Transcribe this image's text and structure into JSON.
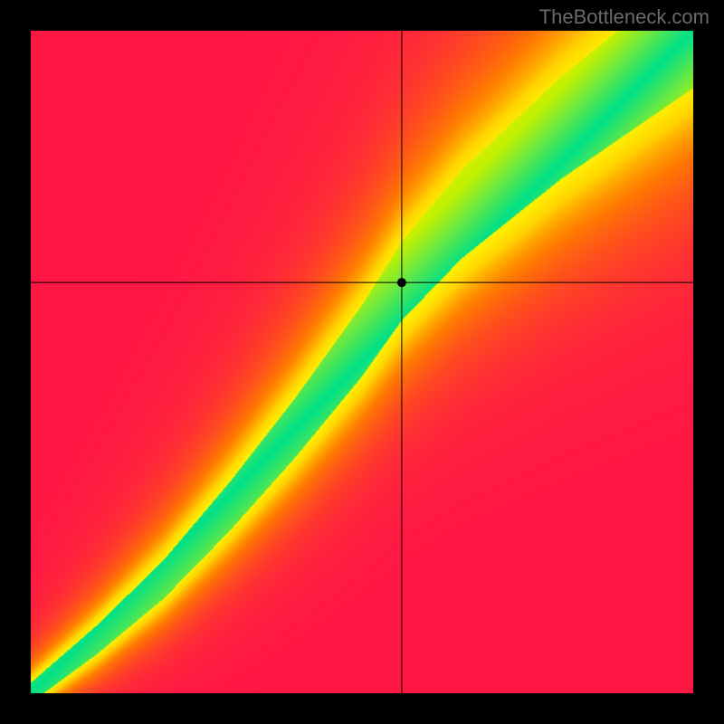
{
  "watermark": "TheBottleneck.com",
  "chart_data": {
    "type": "heatmap",
    "title": "",
    "xlabel": "",
    "ylabel": "",
    "xlim": [
      0,
      1
    ],
    "ylim": [
      0,
      1
    ],
    "crosshair": {
      "x": 0.56,
      "y": 0.62
    },
    "marker": {
      "x": 0.56,
      "y": 0.62
    },
    "optimal_ridge": {
      "description": "green band along which performance is balanced; value 1.0 at ridge, falling to 0 away",
      "points": [
        {
          "x": 0.0,
          "y": 0.0
        },
        {
          "x": 0.1,
          "y": 0.08
        },
        {
          "x": 0.2,
          "y": 0.17
        },
        {
          "x": 0.3,
          "y": 0.28
        },
        {
          "x": 0.4,
          "y": 0.4
        },
        {
          "x": 0.5,
          "y": 0.53
        },
        {
          "x": 0.56,
          "y": 0.62
        },
        {
          "x": 0.65,
          "y": 0.72
        },
        {
          "x": 0.8,
          "y": 0.85
        },
        {
          "x": 1.0,
          "y": 1.0
        }
      ],
      "band_halfwidth_lo": 0.015,
      "band_halfwidth_hi": 0.09
    },
    "color_scale": [
      {
        "t": 0.0,
        "color": "#ff1744"
      },
      {
        "t": 0.35,
        "color": "#ff7a00"
      },
      {
        "t": 0.6,
        "color": "#ffd500"
      },
      {
        "t": 0.78,
        "color": "#fff000"
      },
      {
        "t": 0.9,
        "color": "#c6f000"
      },
      {
        "t": 1.0,
        "color": "#00e08a"
      }
    ]
  }
}
